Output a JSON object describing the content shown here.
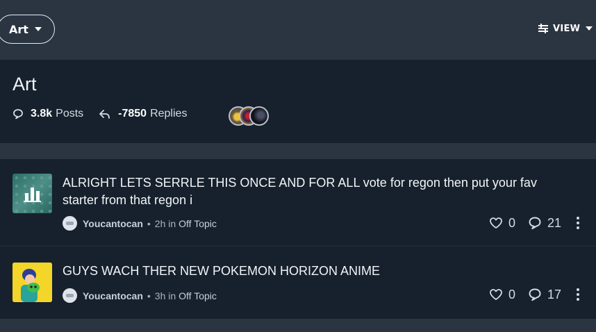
{
  "topbar": {
    "category_label": "Art",
    "view_label": "VIEW",
    "icons": {
      "view": "sliders-icon",
      "dropdown": "caret-down-icon"
    }
  },
  "header": {
    "title": "Art",
    "posts_count": "3.8k",
    "posts_label": "Posts",
    "replies_count": "-7850",
    "replies_label": "Replies",
    "icons": {
      "posts": "chat-bubble-icon",
      "replies": "reply-arrow-icon"
    }
  },
  "posts": [
    {
      "title": "ALRIGHT LETS SERRLE THIS ONCE AND FOR ALL vote for regon then put your fav starter from that regon i",
      "author": "Youcantocan",
      "separator": "•",
      "time": "2h in",
      "category": "Off Topic",
      "likes": "0",
      "replies": "21"
    },
    {
      "title": "GUYS WACH THER NEW POKEMON HORIZON ANIME",
      "author": "Youcantocan",
      "separator": "•",
      "time": "3h in",
      "category": "Off Topic",
      "likes": "0",
      "replies": "17"
    }
  ],
  "colors": {
    "page_bg": "#2b3542",
    "card_bg": "#16212d",
    "text": "#e6ebf0"
  }
}
